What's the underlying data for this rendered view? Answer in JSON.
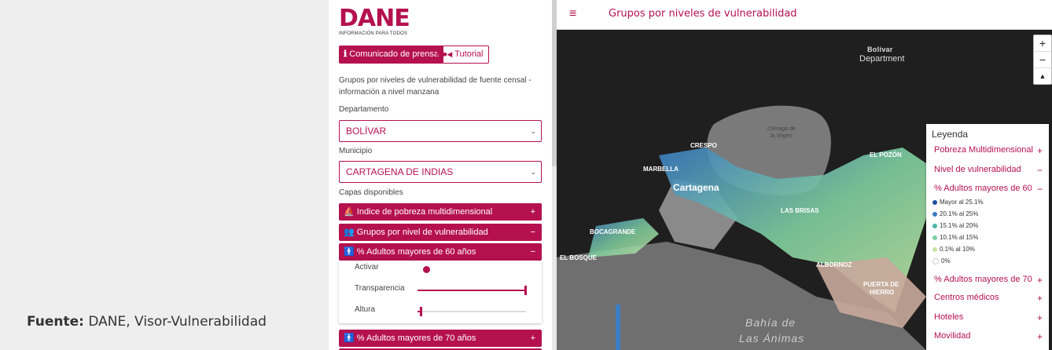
{
  "source": {
    "prefix": "Fuente:",
    "text": "DANE, Visor-Vulnerabilidad"
  },
  "panel": {
    "logo": "DANE",
    "tagline": "INFORMACIÓN PARA TODOS",
    "btn_prensa": "Comunicado de prensa",
    "btn_tutorial": "Tutorial",
    "description": "Grupos por niveles de vulnerabilidad de fuente censal - información a nivel manzana",
    "dept_label": "Departamento",
    "dept_value": "BOLÍVAR",
    "muni_label": "Municipio",
    "muni_value": "CARTAGENA DE INDIAS",
    "layers_label": "Capas disponibles",
    "layers": [
      {
        "label": "Indice de pobreza multidimensional",
        "sign": "+"
      },
      {
        "label": "Grupos por nivel de vulnerabilidad",
        "sign": "−"
      },
      {
        "label": "% Adultos mayores de 60 años",
        "sign": "−"
      },
      {
        "label": "% Adultos mayores de 70 años",
        "sign": "+"
      }
    ],
    "activar": "Activar",
    "transparencia": "Transparencia",
    "altura": "Altura",
    "transparency_level": 1.0,
    "height_level": 0.02
  },
  "header": {
    "menu": "≡",
    "title": "Grupos por niveles de vulnerabilidad"
  },
  "map": {
    "labels": {
      "bolivar": "Bolívar",
      "department": "Department",
      "cienaga_1": "Ciénaga de",
      "cienaga_2": "la Virgen",
      "cartagena": "Cartagena",
      "marbella": "MARBELLA",
      "crespo": "CRESPO",
      "el_pozon": "EL POZÓN",
      "bocagrande": "BOCAGRANDE",
      "el_bosque": "EL BOSQUE",
      "las_brisas": "LAS BRISAS",
      "albornoz": "ALBORNOZ",
      "puerta_hierro_1": "PUERTA DE",
      "puerta_hierro_2": "HIERRO",
      "bahia_1": "Bahía de",
      "bahia_2": "Las Ánimas"
    },
    "zoom_in": "+",
    "zoom_out": "−",
    "compass": "▲"
  },
  "legend": {
    "title": "Leyenda",
    "groups": [
      {
        "label": "Pobreza Multidimensional",
        "sign": "+"
      },
      {
        "label": "Nivel de vulnerabilidad",
        "sign": "−"
      },
      {
        "label": "% Adultos mayores de 60",
        "sign": "−"
      }
    ],
    "items": [
      {
        "label": "Mayor al 25.1%",
        "color": "#1f4fa3"
      },
      {
        "label": "20.1% al 25%",
        "color": "#3b7dc4"
      },
      {
        "label": "15.1% al 20%",
        "color": "#4fb3a9"
      },
      {
        "label": "10.1% al 15%",
        "color": "#7fcf9f"
      },
      {
        "label": "0.1% al 10%",
        "color": "#c4e6a3"
      },
      {
        "label": "0%",
        "color": "#ffffff"
      }
    ],
    "groups_after": [
      {
        "label": "% Adultos mayores de 70",
        "sign": "+"
      },
      {
        "label": "Centros médicos",
        "sign": "+"
      },
      {
        "label": "Hoteles",
        "sign": "+"
      },
      {
        "label": "Movilidad",
        "sign": "+"
      }
    ]
  },
  "colors": {
    "accent": "#b5114f"
  }
}
